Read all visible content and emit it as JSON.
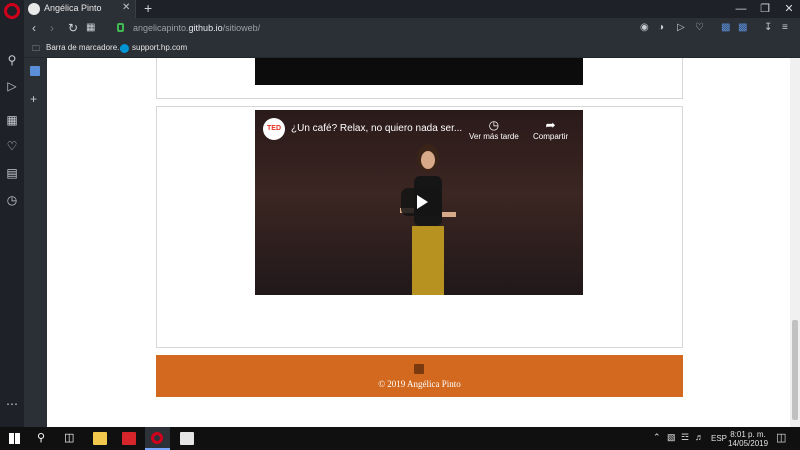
{
  "browser": {
    "tab_title": "Angélica Pinto",
    "url_prefix": "angelicapinto.",
    "url_domain": "github.io",
    "url_path": "/sitioweb/",
    "new_tab_symbol": "+"
  },
  "bookmarks": [
    {
      "label": "Barra de marcadore..."
    },
    {
      "label": "support.hp.com"
    }
  ],
  "video": {
    "channel_logo_text": "TED",
    "title": "¿Un café? Relax, no quiero nada ser...",
    "watch_later_label": "Ver más tarde",
    "share_label": "Compartir"
  },
  "footer": {
    "copyright": "© 2019 Angélica Pinto"
  },
  "taskbar": {
    "time": "8:01 p. m.",
    "date": "14/05/2019",
    "language": "ESP"
  },
  "colors": {
    "footer_bg": "#d2691e",
    "opera_red": "#d0021b",
    "sidebar_bg": "#1e2127"
  }
}
